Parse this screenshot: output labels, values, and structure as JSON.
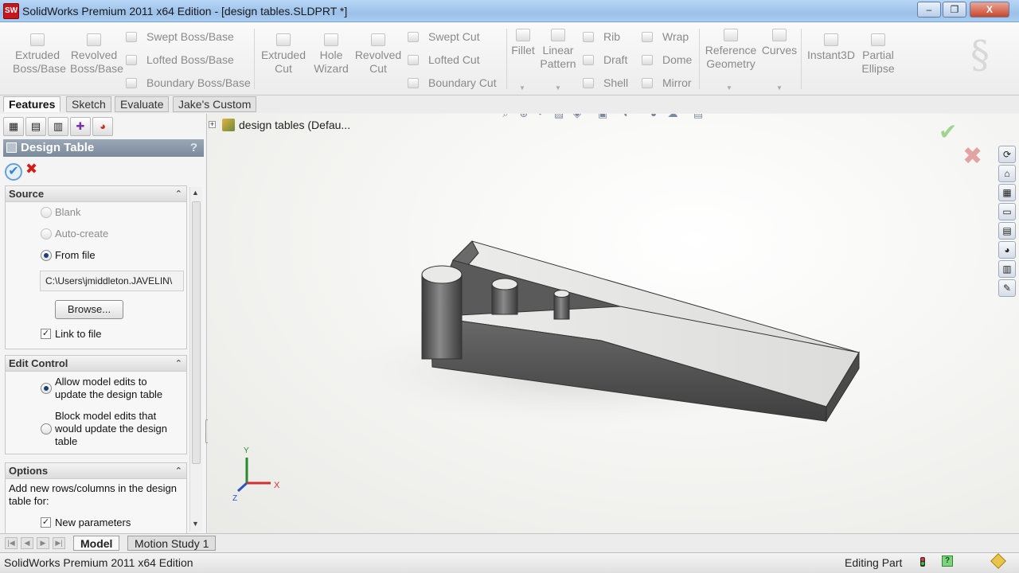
{
  "window": {
    "title": "SolidWorks Premium 2011 x64 Edition - [design tables.SLDPRT *]",
    "logo_text": "SW",
    "minimize_glyph": "–",
    "maximize_glyph": "❐",
    "close_glyph": "X"
  },
  "ribbon": {
    "large_buttons": [
      {
        "id": "extruded-boss-base",
        "label": "Extruded Boss/Base"
      },
      {
        "id": "revolved-boss-base",
        "label": "Revolved Boss/Base"
      },
      {
        "id": "extruded-cut",
        "label": "Extruded Cut"
      },
      {
        "id": "hole-wizard",
        "label": "Hole Wizard"
      },
      {
        "id": "revolved-cut",
        "label": "Revolved Cut"
      },
      {
        "id": "fillet",
        "label": "Fillet"
      },
      {
        "id": "linear-pattern",
        "label": "Linear Pattern"
      },
      {
        "id": "reference-geometry",
        "label": "Reference Geometry"
      },
      {
        "id": "curves",
        "label": "Curves"
      },
      {
        "id": "instant3d",
        "label": "Instant3D"
      },
      {
        "id": "partial-ellipse",
        "label": "Partial Ellipse"
      }
    ],
    "small_buttons": [
      {
        "id": "swept-boss-base",
        "label": "Swept Boss/Base"
      },
      {
        "id": "lofted-boss-base",
        "label": "Lofted Boss/Base"
      },
      {
        "id": "boundary-boss-base",
        "label": "Boundary Boss/Base"
      },
      {
        "id": "swept-cut",
        "label": "Swept Cut"
      },
      {
        "id": "lofted-cut",
        "label": "Lofted Cut"
      },
      {
        "id": "boundary-cut",
        "label": "Boundary Cut"
      },
      {
        "id": "rib",
        "label": "Rib"
      },
      {
        "id": "draft",
        "label": "Draft"
      },
      {
        "id": "shell",
        "label": "Shell"
      },
      {
        "id": "wrap",
        "label": "Wrap"
      },
      {
        "id": "dome",
        "label": "Dome"
      },
      {
        "id": "mirror",
        "label": "Mirror"
      }
    ]
  },
  "command_tabs": [
    "Features",
    "Sketch",
    "Evaluate",
    "Jake's Custom"
  ],
  "property_manager": {
    "title": "Design Table",
    "help": "?",
    "ok_glyph": "✔",
    "cancel_glyph": "✖",
    "source": {
      "heading": "Source",
      "options": [
        "Blank",
        "Auto-create",
        "From file"
      ],
      "selected": "From file",
      "file_path": "C:\\Users\\jmiddleton.JAVELIN\\",
      "browse_label": "Browse...",
      "link_to_file_label": "Link to file",
      "link_to_file_checked": true
    },
    "edit_control": {
      "heading": "Edit Control",
      "options": [
        "Allow model edits to update the design table",
        "Block model edits that would update the design table"
      ],
      "selected": "Allow model edits to update the design table"
    },
    "options": {
      "heading": "Options",
      "description": "Add new rows/columns in the design table for:",
      "new_parameters_label": "New parameters",
      "new_parameters_checked": true
    }
  },
  "graphics": {
    "tree_root_label": "design tables  (Defau...",
    "confirm_ok_glyph": "✔",
    "confirm_cancel_glyph": "✖",
    "triad": {
      "x": "X",
      "y": "Y",
      "z": "Z"
    }
  },
  "taskpane_icons": [
    "solidworks-resources-icon",
    "home-icon",
    "design-library-icon",
    "file-explorer-icon",
    "view-palette-icon",
    "appearances-icon",
    "custom-properties-icon",
    "toolbox-icon"
  ],
  "bottom_tabs": [
    "Model",
    "Motion Study 1"
  ],
  "status_bar": {
    "product": "SolidWorks Premium 2011 x64 Edition",
    "mode": "Editing Part",
    "help_glyph": "?"
  },
  "colors": {
    "titlebar": "#a9cbef",
    "pm_header": "#7b8a9b",
    "model_light": "#e5e5e3",
    "model_dark": "#4a4a4a"
  }
}
